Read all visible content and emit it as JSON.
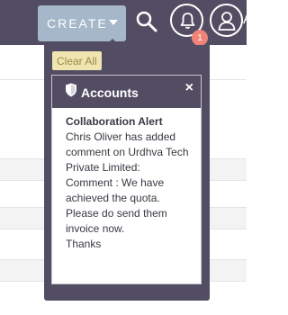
{
  "header": {
    "create_label": "CREATE",
    "notification_count": "1",
    "user_initial": "A"
  },
  "dropdown": {
    "clear_all_label": "Clear All",
    "notification": {
      "module": "Accounts",
      "close_glyph": "×",
      "subject": "Collaboration Alert",
      "message_lines": [
        "Chris Oliver has added",
        "comment on Urdhva Tech",
        "Private Limited:",
        "Comment : We have",
        "achieved the quota.",
        "Please do send them",
        "invoice now.",
        "Thanks"
      ]
    }
  },
  "colors": {
    "topbar": "#534d64",
    "create_button": "#a5b7c8",
    "badge": "#f08377",
    "clear_all_bg": "#f0e4b0"
  },
  "icons": [
    "search-icon",
    "bell-icon",
    "avatar-icon",
    "shield-icon",
    "close-icon",
    "chevron-down-icon"
  ]
}
